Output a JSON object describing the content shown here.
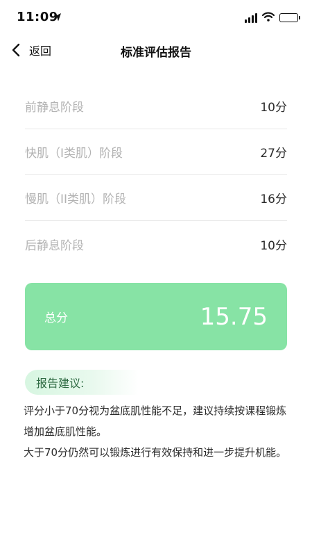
{
  "status_bar": {
    "time": "11:09",
    "location_icon": "location-arrow-icon",
    "signal_icon": "cellular-signal-icon",
    "wifi_icon": "wifi-icon",
    "battery_icon": "battery-icon"
  },
  "nav": {
    "back_label": "返回",
    "title": "标准评估报告"
  },
  "scores": [
    {
      "label": "前静息阶段",
      "value": "10分"
    },
    {
      "label": "快肌（I类肌）阶段",
      "value": "27分"
    },
    {
      "label": "慢肌（II类肌）阶段",
      "value": "16分"
    },
    {
      "label": "后静息阶段",
      "value": "10分"
    }
  ],
  "total": {
    "label": "总分",
    "value": "15.75"
  },
  "advice": {
    "title": "报告建议:",
    "lines": [
      "评分小于70分视为盆底肌性能不足，建议持续按课程锻炼增加盆底肌性能。",
      "大于70分仍然可以锻炼进行有效保持和进一步提升机能。"
    ]
  },
  "colors": {
    "accent_green": "#87e3a5",
    "advice_green": "#2f6b43",
    "muted_label": "#b3b3b3"
  }
}
